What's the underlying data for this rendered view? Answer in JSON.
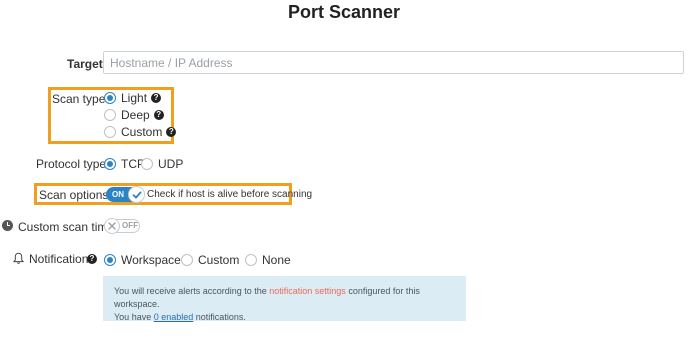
{
  "title": "Port Scanner",
  "target": {
    "label": "Target",
    "placeholder": "Hostname / IP Address",
    "value": ""
  },
  "scan_type": {
    "label": "Scan type",
    "options": [
      {
        "label": "Light",
        "checked": true
      },
      {
        "label": "Deep",
        "checked": false
      },
      {
        "label": "Custom",
        "checked": false
      }
    ],
    "help_glyph": "?"
  },
  "protocol_type": {
    "label": "Protocol type",
    "options": [
      {
        "label": "TCP",
        "checked": true
      },
      {
        "label": "UDP",
        "checked": false
      }
    ]
  },
  "scan_options": {
    "label": "Scan options",
    "toggle_text": "ON",
    "toggle_state": true,
    "description": "Check if host is alive before scanning"
  },
  "custom_scan_time": {
    "label": "Custom scan time",
    "toggle_text": "OFF",
    "toggle_state": false
  },
  "notifications": {
    "label": "Notifications",
    "options": [
      {
        "label": "Workspace",
        "checked": true
      },
      {
        "label": "Custom",
        "checked": false
      },
      {
        "label": "None",
        "checked": false
      }
    ],
    "info": {
      "line1_prefix": "You will receive alerts according to the",
      "line1_link": "notification settings",
      "line1_suffix": "configured for this workspace.",
      "line2_prefix": "You have",
      "line2_link": "0 enabled",
      "line2_suffix": "notifications."
    }
  },
  "colors": {
    "accent": "#2a84c6",
    "highlight": "#f0a020",
    "info_bg": "#dcecf5",
    "link_red": "#e86a5a"
  }
}
